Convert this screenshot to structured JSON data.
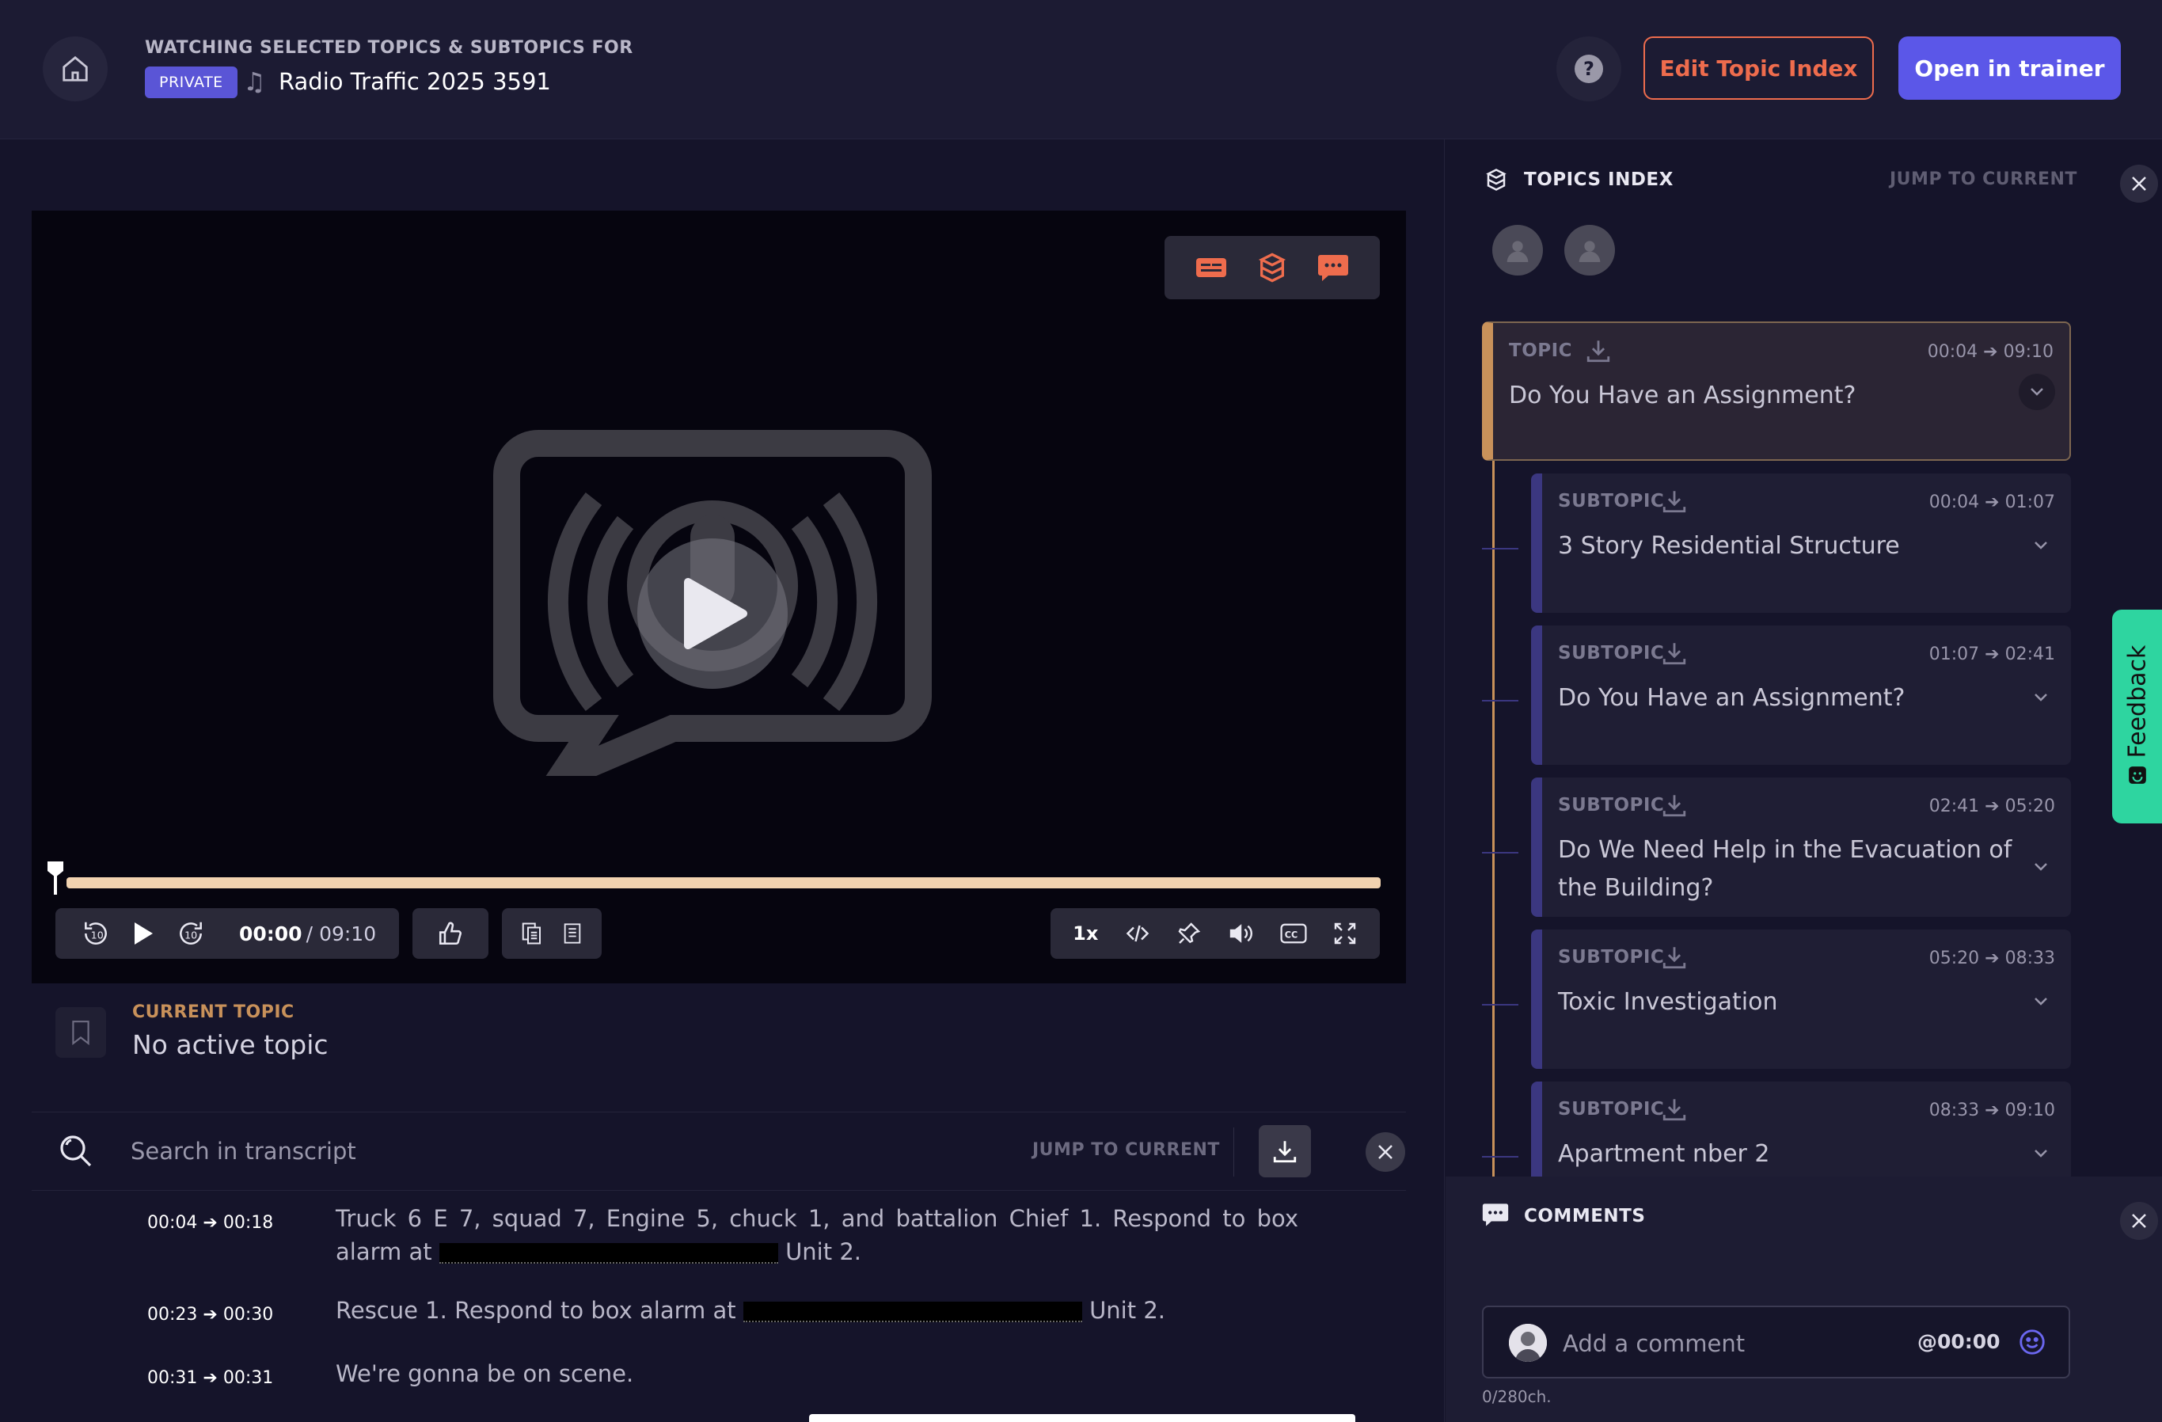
{
  "header": {
    "watching_label": "WATCHING SELECTED TOPICS & SUBTOPICS FOR",
    "private_badge": "PRIVATE",
    "title": "Radio Traffic 2025 3591",
    "help_label": "?",
    "edit_button": "Edit Topic Index",
    "open_button": "Open in trainer"
  },
  "player": {
    "current_time": "00:00",
    "separator": "/",
    "duration": "09:10",
    "speed": "1x",
    "progress_fraction": 0.0
  },
  "current_topic": {
    "label": "CURRENT TOPIC",
    "value": "No active topic"
  },
  "transcript": {
    "search_placeholder": "Search in transcript",
    "jump_label": "JUMP TO CURRENT",
    "lines": [
      {
        "start": "00:04",
        "end": "00:18",
        "text_before": "Truck 6 E 7, squad 7, Engine 5, chuck 1, and battalion Chief 1. Respond to box alarm at",
        "text_after": "Unit 2."
      },
      {
        "start": "00:23",
        "end": "00:30",
        "text_before": "Rescue 1. Respond to box alarm at",
        "text_after": "Unit 2."
      },
      {
        "start": "00:31",
        "end": "00:31",
        "text_before": "We're gonna be on scene.",
        "text_after": ""
      }
    ]
  },
  "topics_index": {
    "label": "TOPICS INDEX",
    "jump_label": "JUMP TO CURRENT",
    "topic": {
      "type": "TOPIC",
      "start": "00:04",
      "end": "09:10",
      "title": "Do You Have an Assignment?"
    },
    "subtopics": [
      {
        "type": "SUBTOPIC",
        "start": "00:04",
        "end": "01:07",
        "title": "3 Story Residential Structure"
      },
      {
        "type": "SUBTOPIC",
        "start": "01:07",
        "end": "02:41",
        "title": "Do You Have an Assignment?"
      },
      {
        "type": "SUBTOPIC",
        "start": "02:41",
        "end": "05:20",
        "title": "Do We Need Help in the Evacuation of the Building?"
      },
      {
        "type": "SUBTOPIC",
        "start": "05:20",
        "end": "08:33",
        "title": "Toxic Investigation"
      },
      {
        "type": "SUBTOPIC",
        "start": "08:33",
        "end": "09:10",
        "title": "Apartment nber 2"
      }
    ]
  },
  "comments": {
    "label": "COMMENTS",
    "placeholder": "Add a comment",
    "timestamp": "@00:00",
    "char_count": "0/280ch."
  },
  "feedback_label": "Feedback",
  "colors": {
    "accent": "#5b57e8",
    "orange": "#ee6c4d",
    "topic_gold": "#c8915a",
    "subtopic_purple": "#3b3780",
    "feedback_green": "#2ed5a0"
  }
}
